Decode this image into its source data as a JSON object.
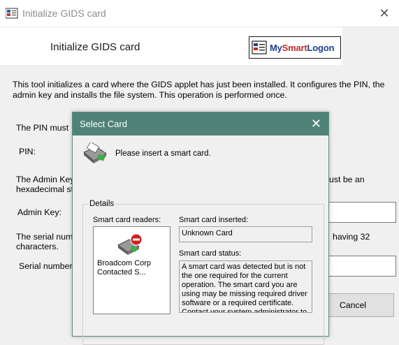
{
  "window": {
    "title": "Initialize GIDS card",
    "heading": "Initialize GIDS card",
    "logo": {
      "part1": "My",
      "part2": "Smart",
      "part3": "Logon"
    },
    "description": "This tool initializes a card where the GIDS applet has just been installed. It configures the PIN, the admin key and installs the file system. This operation is performed once.",
    "pin_note": "The PIN must",
    "pin_label": "PIN:",
    "admin_key_note_left": "The Admin Key",
    "admin_key_note_left2": "hexadecimal st",
    "admin_key_note_right": "ust be an",
    "admin_key_label": "Admin Key:",
    "serial_note_left": "The serial num",
    "serial_note_left2": "characters.",
    "serial_note_right": "having 32",
    "serial_label": "Serial number:",
    "cancel_label": "Cancel"
  },
  "dialog": {
    "title": "Select Card",
    "message": "Please insert a smart card.",
    "details_label": "Details",
    "readers_label": "Smart card readers:",
    "reader_name": "Broadcom Corp Contacted S...",
    "inserted_label": "Smart card inserted:",
    "inserted_value": "Unknown Card",
    "status_label": "Smart card status:",
    "status_value": "A smart card was detected but is not the one required for the current operation. The smart card you are using may be missing required driver software or a required certificate. Contact your system administrator to"
  },
  "colors": {
    "dialog_title_bg": "#4f8377",
    "window_bg": "#f0f0f0",
    "logo_blue": "#1f3f8f",
    "logo_red": "#c42b2b"
  },
  "icons": [
    "app-icon",
    "close-icon",
    "logo-icon",
    "smart-card-reader-icon",
    "reader-error-icon"
  ]
}
